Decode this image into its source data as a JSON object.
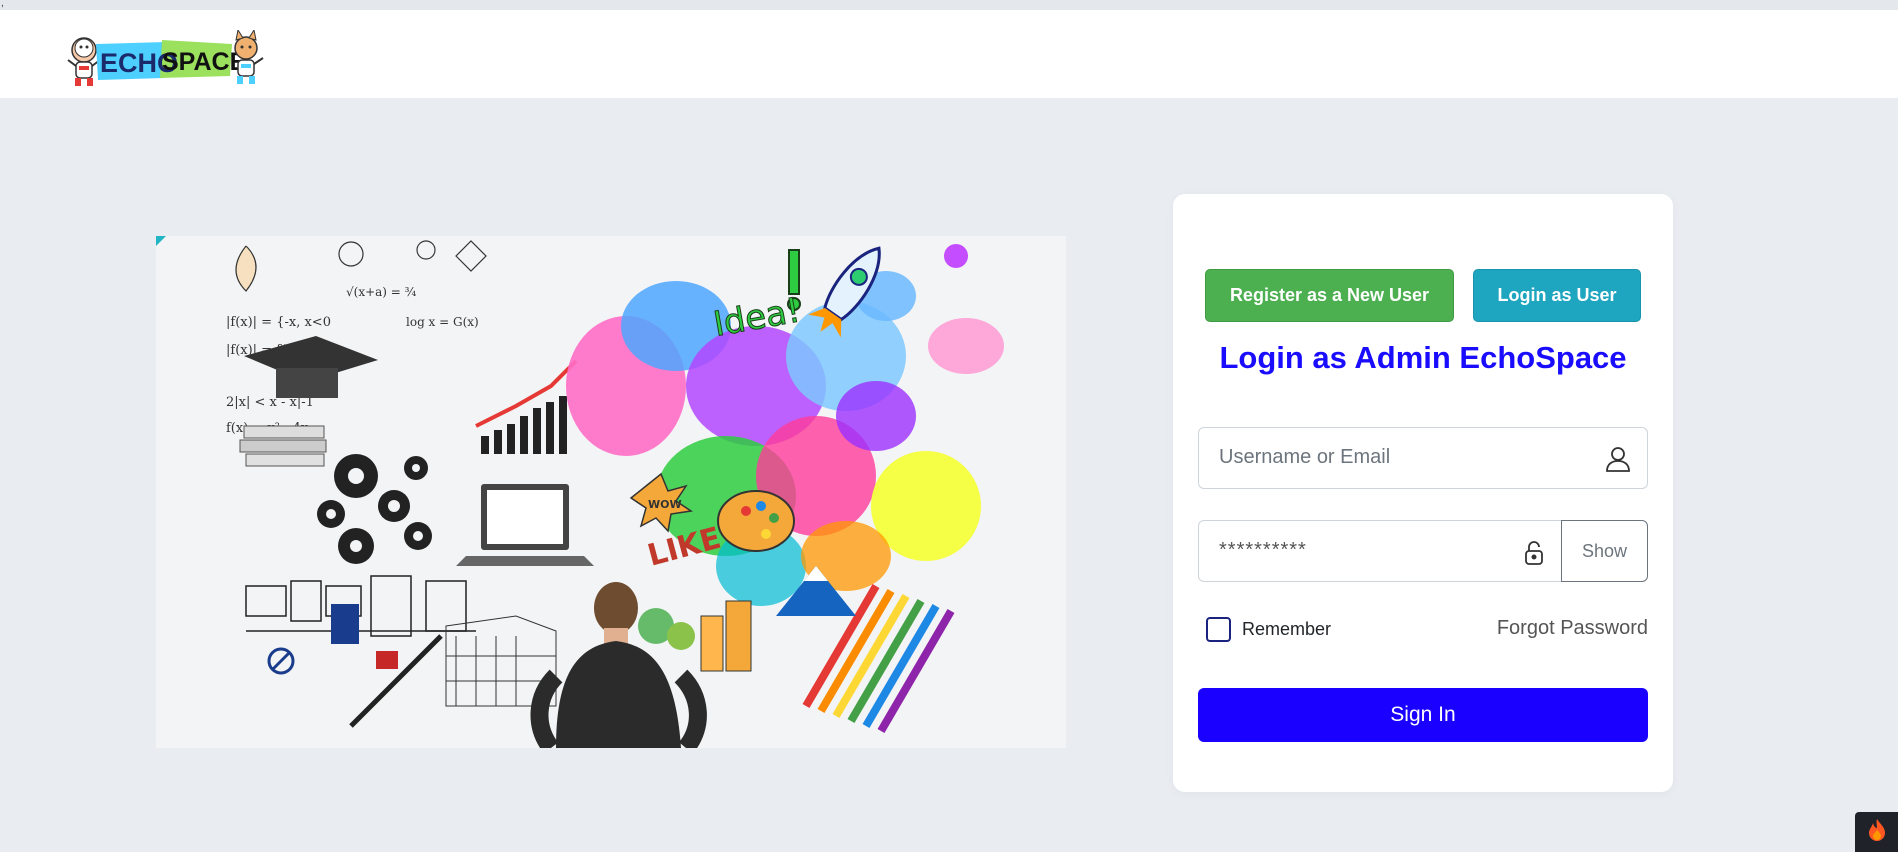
{
  "top_strip": {
    "mark": ","
  },
  "logo": {
    "text_echo": "ECHO",
    "text_space": "SPACE"
  },
  "auth": {
    "register_button": "Register as a New User",
    "login_user_button": "Login as User",
    "title": "Login as Admin EchoSpace",
    "username_placeholder": "Username or Email",
    "password_value": "**********",
    "show_button": "Show",
    "remember_label": "Remember",
    "forgot_link": "Forgot Password",
    "signin_button": "Sign In"
  },
  "colors": {
    "register": "#4caf50",
    "login_user": "#1ea5bf",
    "title": "#1a0dff",
    "signin": "#1a00ff",
    "page_bg": "#e9edf2"
  },
  "icons": {
    "username": "user-icon",
    "password": "lock-icon",
    "corner": "flame-icon"
  }
}
